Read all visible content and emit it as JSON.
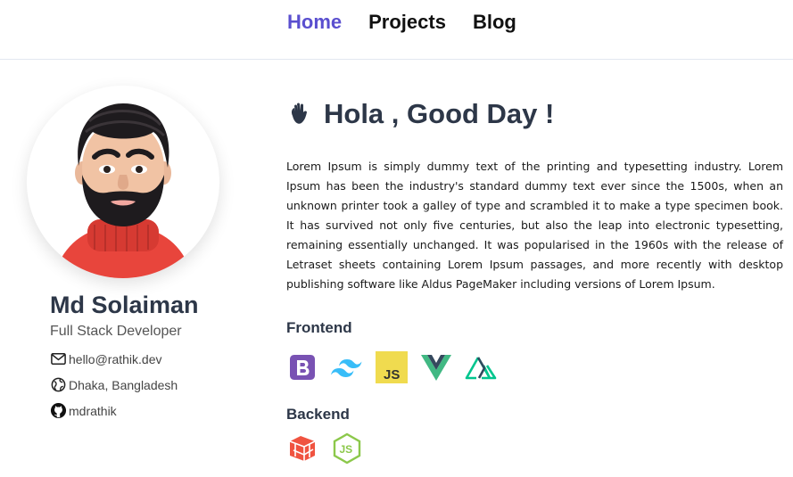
{
  "nav": {
    "items": [
      {
        "label": "Home",
        "active": true
      },
      {
        "label": "Projects",
        "active": false
      },
      {
        "label": "Blog",
        "active": false
      }
    ]
  },
  "profile": {
    "name": "Md Solaiman",
    "role": "Full Stack Developer",
    "email": "hello@rathik.dev",
    "location": "Dhaka, Bangladesh",
    "github": "mdrathik"
  },
  "greeting": {
    "emoji": "👋",
    "title": "Hola , Good Day !"
  },
  "bio": "Lorem Ipsum is simply dummy text of the printing and typesetting industry. Lorem Ipsum has been the industry's standard dummy text ever since the 1500s, when an unknown printer took a galley of type and scrambled it to make a type specimen book. It has survived not only five centuries, but also the leap into electronic typesetting, remaining essentially unchanged. It was popularised in the 1960s with the release of Letraset sheets containing Lorem Ipsum passages, and more recently with desktop publishing software like Aldus PageMaker including versions of Lorem Ipsum.",
  "skills": {
    "frontend": {
      "title": "Frontend",
      "icons": [
        "bootstrap-icon",
        "tailwind-icon",
        "javascript-icon",
        "vue-icon",
        "nuxt-icon"
      ]
    },
    "backend": {
      "title": "Backend",
      "icons": [
        "laravel-icon",
        "nodejs-icon"
      ]
    }
  },
  "colors": {
    "accent": "#5a4fcf",
    "text": "#2d3748",
    "bootstrap": "#7952b3",
    "tailwind": "#38bdf8",
    "javascript": "#f0db4f",
    "vue": "#41b883",
    "vue_dark": "#35495e",
    "nuxt": "#00c58e",
    "laravel": "#f05340",
    "nodejs": "#8cc84b"
  }
}
